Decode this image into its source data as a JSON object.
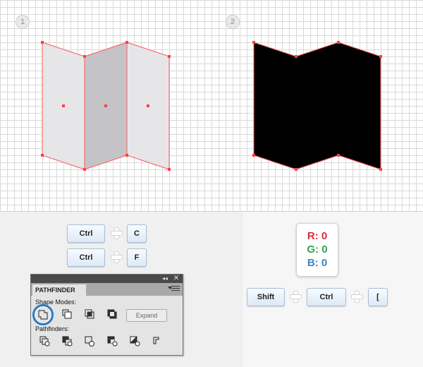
{
  "steps": [
    "1",
    "2"
  ],
  "keys": {
    "ctrl": "Ctrl",
    "c": "C",
    "f": "F",
    "shift": "Shift",
    "bracket": "["
  },
  "rgb": {
    "r": "R: 0",
    "g": "G: 0",
    "b": "B: 0"
  },
  "colors": {
    "anchor": "#ff5a5a",
    "panel_light": "#e6e6e9",
    "panel_dark": "#c4c4c8",
    "fill": "#000000",
    "r": "#d72d3b",
    "g": "#2fa44f",
    "b": "#3a86c4",
    "highlight": "#2a7ac2"
  },
  "pathfinder": {
    "tab": "PATHFINDER",
    "shape_modes_label": "Shape Modes:",
    "pathfinders_label": "Pathfinders:",
    "expand_label": "Expand",
    "shape_mode_buttons": [
      "unite-icon",
      "minus-front-icon",
      "intersect-icon",
      "exclude-icon"
    ],
    "pathfinder_buttons": [
      "divide-icon",
      "trim-icon",
      "merge-icon",
      "crop-icon",
      "outline-icon",
      "minus-back-icon"
    ]
  }
}
